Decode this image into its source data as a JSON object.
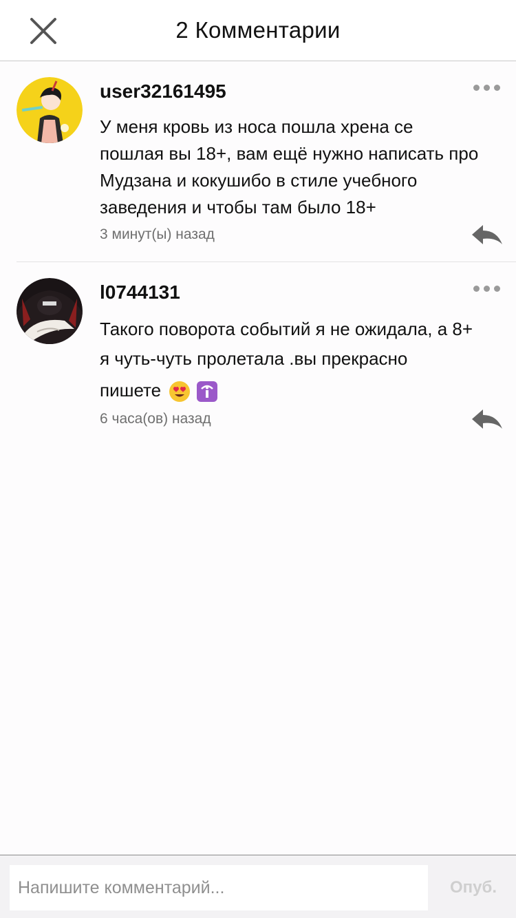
{
  "header": {
    "title": "2 Комментарии",
    "close_icon": "close-icon"
  },
  "comments": [
    {
      "username": "user32161495",
      "text_lines": [
        "У меня кровь из носа пошла хрена се",
        "пошлая вы 18+, вам ещё нужно написать про",
        "Мудзана и кокушибо в стиле учебного",
        "заведения и чтобы там было 18+"
      ],
      "time": "3 минут(ы) назад",
      "avatar": "anime-character-avatar-yellow",
      "more_icon": "more-dots-icon",
      "reply_icon": "reply-arrow-icon"
    },
    {
      "username": "l0744131",
      "text_lines": [
        "Такого поворота событий я не ожидала, а 8+",
        "я чуть-чуть пролетала .вы прекрасно",
        "пишете"
      ],
      "emojis": [
        "heart-eyes-emoji",
        "info-emoji"
      ],
      "time": "6 часа(ов) назад",
      "avatar": "anime-character-avatar-dark",
      "more_icon": "more-dots-icon",
      "reply_icon": "reply-arrow-icon"
    }
  ],
  "composer": {
    "placeholder": "Напишите комментарий...",
    "value": "",
    "publish_label": "Опуб."
  },
  "colors": {
    "background": "#fdfcfd",
    "header_border": "#c9c9c9",
    "secondary_text": "#6f6f6f",
    "icon_gray": "#9a9a9a",
    "publish_disabled": "#cfcfcf"
  }
}
